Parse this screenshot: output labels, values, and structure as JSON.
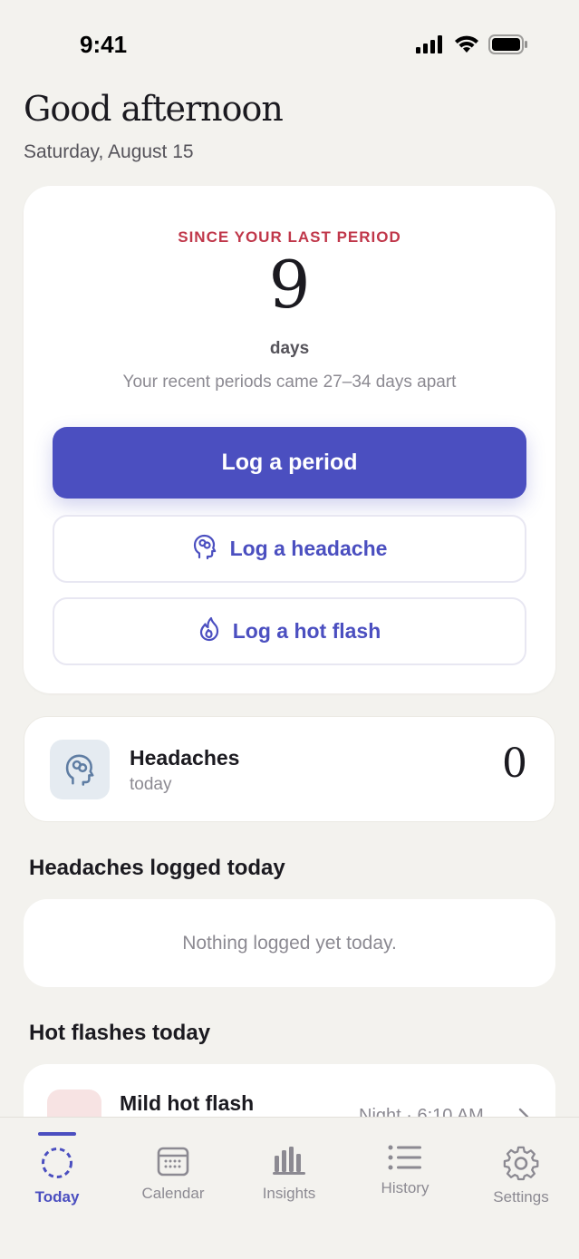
{
  "status_bar": {
    "time": "9:41"
  },
  "header": {
    "greeting": "Good afternoon",
    "date": "Saturday, August 15"
  },
  "period_card": {
    "label": "SINCE YOUR LAST PERIOD",
    "days_count": "9",
    "days_unit": "days",
    "hint": "Your recent periods came 27–34 days apart",
    "log_period_label": "Log a period",
    "log_headache_label": "Log a headache",
    "log_hot_flash_label": "Log a hot flash"
  },
  "headache_stat": {
    "title": "Headaches",
    "subtitle": "today",
    "count": "0"
  },
  "headaches_section": {
    "title": "Headaches logged today",
    "empty_text": "Nothing logged yet today."
  },
  "hot_flashes_section": {
    "title": "Hot flashes today",
    "entries": [
      {
        "title": "Mild hot flash",
        "time": "Night · 6:10 AM"
      }
    ]
  },
  "tab_bar": {
    "tabs": [
      {
        "label": "Today",
        "icon": "today-ring-icon",
        "active": true
      },
      {
        "label": "Calendar",
        "icon": "calendar-icon",
        "active": false
      },
      {
        "label": "Insights",
        "icon": "bar-chart-icon",
        "active": false
      },
      {
        "label": "History",
        "icon": "list-icon",
        "active": false
      },
      {
        "label": "Settings",
        "icon": "gear-icon",
        "active": false
      }
    ]
  },
  "colors": {
    "accent": "#4b4fc0",
    "alert_label": "#c0374a",
    "background": "#f3f2ee"
  }
}
